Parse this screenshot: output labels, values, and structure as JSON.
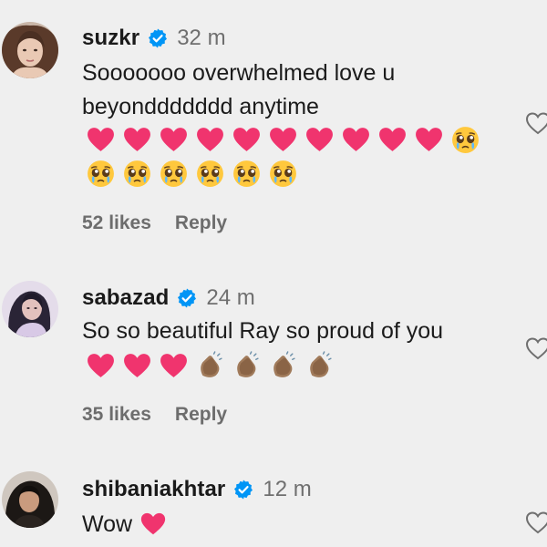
{
  "comments": [
    {
      "username": "suzkr",
      "time": "32 m",
      "text_lines": [
        "Sooooooo overwhelmed love u",
        "beyonddddddd anytime"
      ],
      "emoji_rows": [
        [
          "heart-emoji",
          "heart-emoji",
          "heart-emoji",
          "heart-emoji",
          "heart-emoji",
          "heart-emoji",
          "heart-emoji",
          "heart-emoji",
          "heart-emoji",
          "heart-emoji",
          "pleading-face-emoji"
        ],
        [
          "pleading-face-emoji",
          "pleading-face-emoji",
          "pleading-face-emoji",
          "pleading-face-emoji",
          "pleading-face-emoji",
          "pleading-face-emoji"
        ]
      ],
      "likes": "52 likes",
      "reply": "Reply"
    },
    {
      "username": "sabazad",
      "time": "24 m",
      "text_lines": [
        "So so beautiful Ray so proud of you"
      ],
      "emoji_rows": [
        [
          "heart-emoji",
          "heart-emoji",
          "heart-emoji",
          "clapping-hands-emoji",
          "clapping-hands-emoji",
          "clapping-hands-emoji",
          "clapping-hands-emoji"
        ]
      ],
      "likes": "35 likes",
      "reply": "Reply"
    },
    {
      "username": "shibaniakhtar",
      "time": "12 m",
      "text_lines": [
        "Wow"
      ],
      "emoji_rows": [],
      "inline_emoji": "heart-emoji"
    }
  ],
  "colors": {
    "background": "#efefef",
    "verified_badge": "#0095f6",
    "heart": "#f0346e",
    "muted_text": "#6f6f6f"
  }
}
